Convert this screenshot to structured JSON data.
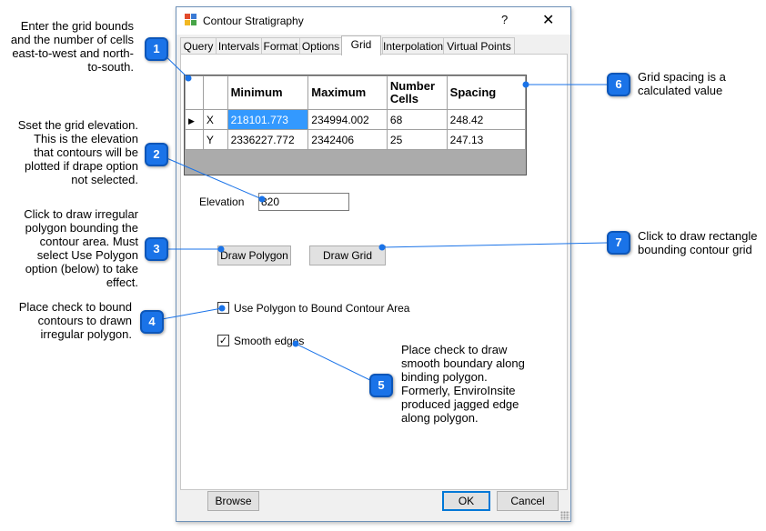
{
  "window": {
    "title": "Contour Stratigraphy",
    "help_glyph": "?",
    "close_glyph": "✕"
  },
  "tabs": [
    "Query",
    "Intervals",
    "Format",
    "Options",
    "Grid",
    "Interpolation",
    "Virtual Points"
  ],
  "active_tab": "Grid",
  "grid": {
    "headers": [
      "Minimum",
      "Maximum",
      "Number Cells",
      "Spacing"
    ],
    "rows": [
      {
        "label": "X",
        "minimum": "218101.773",
        "maximum": "234994.002",
        "number_cells": "68",
        "spacing": "248.42"
      },
      {
        "label": "Y",
        "minimum": "2336227.772",
        "maximum": "2342406",
        "number_cells": "25",
        "spacing": "247.13"
      }
    ]
  },
  "elevation": {
    "label": "Elevation",
    "value": "820"
  },
  "buttons": {
    "draw_polygon": "Draw Polygon",
    "draw_grid": "Draw Grid",
    "browse": "Browse",
    "ok": "OK",
    "cancel": "Cancel"
  },
  "checkboxes": {
    "use_polygon": {
      "label": "Use Polygon to Bound Contour Area",
      "checked": false
    },
    "smooth_edges": {
      "label": "Smooth edges",
      "checked": true
    }
  },
  "callouts": [
    {
      "number": "1",
      "lines": [
        "Enter the grid bounds",
        "and the number of cells",
        "east-to-west and north-",
        "to-south."
      ]
    },
    {
      "number": "2",
      "lines": [
        "Sset the grid elevation.",
        "This is the elevation",
        "that contours will be",
        "plotted if drape option",
        "not selected."
      ]
    },
    {
      "number": "3",
      "lines": [
        "Click to draw irregular",
        "polygon bounding the",
        "contour area.  Must",
        "select Use Polygon",
        "option (below) to take",
        "effect."
      ]
    },
    {
      "number": "4",
      "lines": [
        "Place check to bound",
        "contours to drawn",
        "irregular polygon."
      ]
    },
    {
      "number": "5",
      "lines": [
        "Place check to draw",
        "smooth boundary along",
        "binding polygon.",
        "Formerly, EnviroInsite",
        "produced jagged edge",
        "along polygon."
      ]
    },
    {
      "number": "6",
      "lines": [
        "Grid spacing is a",
        "calculated value"
      ]
    },
    {
      "number": "7",
      "lines": [
        "Click to draw rectangle",
        "bounding contour grid"
      ]
    }
  ],
  "colors": {
    "callout_blue": "#1a73e8",
    "selection": "#3399ff",
    "default_button_border": "#0078d7"
  }
}
